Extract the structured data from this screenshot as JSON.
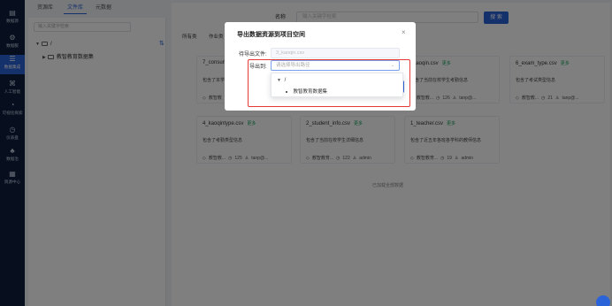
{
  "sidebar": {
    "items": [
      {
        "label": "数据源",
        "icon": "database-icon",
        "glyph": "▤"
      },
      {
        "label": "数据服",
        "icon": "service-icon",
        "glyph": "⚙"
      },
      {
        "label": "数据集成",
        "icon": "integration-icon",
        "glyph": "☰"
      },
      {
        "label": "人工智能",
        "icon": "ai-icon",
        "glyph": "⌘"
      },
      {
        "label": "可视化探索",
        "icon": "visual-icon",
        "glyph": "◔"
      },
      {
        "label": "仪表盘",
        "icon": "dashboard-icon",
        "glyph": "◷"
      },
      {
        "label": "数据治",
        "icon": "governance-icon",
        "glyph": "♣"
      },
      {
        "label": "资源中心",
        "icon": "resource-icon",
        "glyph": "▦"
      }
    ]
  },
  "tabs": [
    "资源库",
    "文件库",
    "元数据"
  ],
  "left_panel": {
    "search_placeholder": "输入关键字检索",
    "add_glyph": "⇅",
    "tree_root": "/",
    "tree_child": "教智教育数据集"
  },
  "content": {
    "name_label": "名称",
    "search_placeholder": "输入关键字检索",
    "search_button": "搜 索",
    "subtabs": [
      "所有类",
      "作业类"
    ],
    "all_loaded": "已加载全部数据"
  },
  "cards": [
    {
      "title": "7_consum",
      "more": "",
      "desc": "包含了本学期",
      "tag": "教智教",
      "count": "",
      "user": ""
    },
    {
      "title": "_kaoqin.csv",
      "more": "更多",
      "desc": "包含了当前在校学生考勤信息",
      "tag": "教智教...",
      "count": "126",
      "user": "tanp@..."
    },
    {
      "title": "6_exam_type.csv",
      "more": "更多",
      "desc": "包含了考试类型信息",
      "tag": "教智教...",
      "count": "21",
      "user": "tanp@..."
    },
    {
      "title": "4_kaoqintype.csv",
      "more": "更多",
      "desc": "包含了考勤类型信息",
      "tag": "教智教...",
      "count": "125",
      "user": "tanp@..."
    },
    {
      "title": "2_student_info.csv",
      "more": "更多",
      "desc": "包含了当前在校学生详细信息",
      "tag": "教智教育...",
      "count": "122",
      "user": "admin"
    },
    {
      "title": "1_teacher.csv",
      "more": "更多",
      "desc": "包含了近五年各班各学科的教师信息",
      "tag": "教智教育...",
      "count": "19",
      "user": "admin"
    }
  ],
  "modal": {
    "title": "导出数据资源到项目空间",
    "close_glyph": "×",
    "file_label": "待导出文件:",
    "file_value": "3_kaoqin.csv",
    "target_label": "导出到:",
    "target_placeholder": "请选择导出路径",
    "dropdown_root": "/",
    "dropdown_child": "教智教育数据集"
  },
  "colors": {
    "accent": "#2b63d9",
    "sidebar": "#0f1f3d",
    "highlight": "#e53935",
    "more": "#18a058"
  }
}
